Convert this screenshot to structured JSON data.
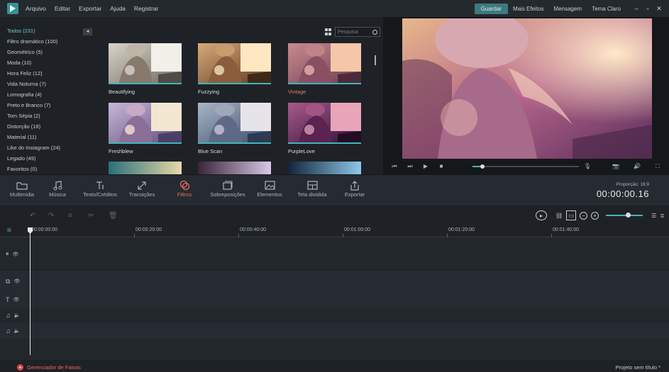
{
  "menu": [
    "Arquivo",
    "Editar",
    "Exportar",
    "Ajuda",
    "Registrar"
  ],
  "top": {
    "save": "Guardar",
    "more_effects": "Mais Efeitos",
    "message": "Mensagem",
    "theme": "Tema Claro"
  },
  "categories": [
    "Todos (231)",
    "Filtro dramático (100)",
    "Geométrico (5)",
    "Moda (10)",
    "Hora Feliz (12)",
    "Vida Noturna (7)",
    "Lomografia (4)",
    "Preto e Branco (7)",
    "Tom Sépia (2)",
    "Distorção (18)",
    "Material (11)",
    "Like do Instagram (24)",
    "Legado (49)",
    "Favoritos (0)"
  ],
  "search": {
    "placeholder": "Pesquisa"
  },
  "filters": [
    {
      "label": "Beautifying"
    },
    {
      "label": "Fuzzying"
    },
    {
      "label": "Vintage"
    },
    {
      "label": "Freshblew"
    },
    {
      "label": "Blue Scan"
    },
    {
      "label": "PurpleLove"
    }
  ],
  "tools": [
    {
      "label": "Multimídia",
      "icon": "folder-icon"
    },
    {
      "label": "Música",
      "icon": "music-icon"
    },
    {
      "label": "Texto/Créditos",
      "icon": "text-icon"
    },
    {
      "label": "Transições",
      "icon": "transition-icon"
    },
    {
      "label": "Filtros",
      "icon": "filter-icon"
    },
    {
      "label": "Sobreposições",
      "icon": "overlay-icon"
    },
    {
      "label": "Elementos",
      "icon": "elements-icon"
    },
    {
      "label": "Tela dividida",
      "icon": "split-screen-icon"
    },
    {
      "label": "Exportar",
      "icon": "export-icon"
    }
  ],
  "timeinfo": {
    "ratio": "Proporção: 16:9",
    "timecode": "00:00:00.16"
  },
  "ruler": [
    "00:00:00:00",
    "00:00:20:00",
    "00:00:40:00",
    "00:01:00:00",
    "00:01:20:00",
    "00:01:40:00"
  ],
  "bottom": {
    "track_manager": "Gerenciador de Faixas",
    "project": "Projeto sem título *"
  },
  "colors": {
    "accent": "#3fb6bb",
    "active_tool": "#e86a5d",
    "save_button": "#3d7a7e"
  }
}
